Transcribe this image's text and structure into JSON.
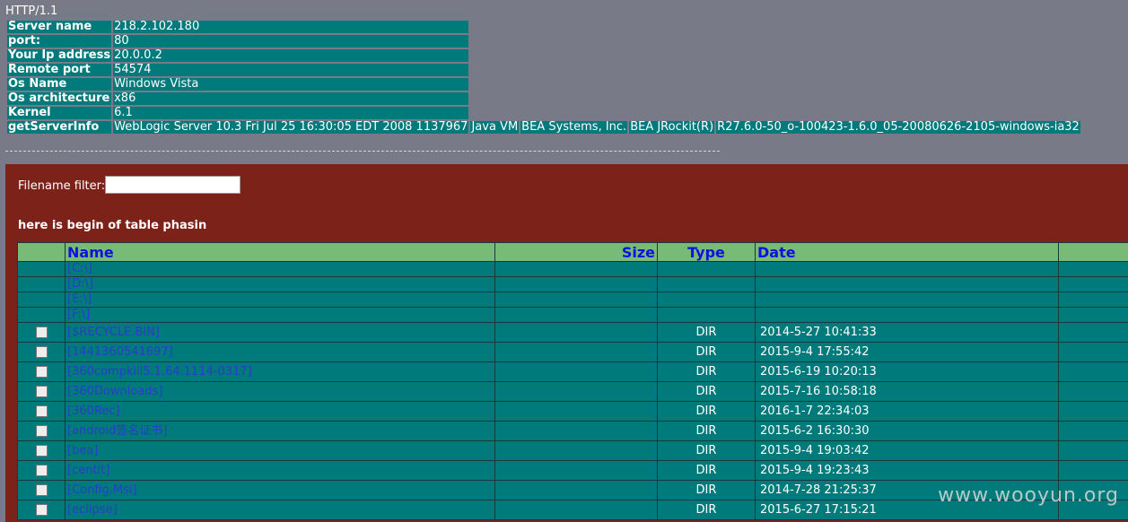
{
  "protocol": "HTTP/1.1",
  "info": [
    {
      "key": "Server name",
      "value": "218.2.102.180"
    },
    {
      "key": "port:",
      "value": "80"
    },
    {
      "key": "Your Ip address",
      "value": "20.0.0.2"
    },
    {
      "key": "Remote port",
      "value": "54574"
    },
    {
      "key": "Os Name",
      "value": "Windows Vista"
    },
    {
      "key": "Os architecture",
      "value": "x86"
    },
    {
      "key": "Kernel",
      "value": "6.1"
    }
  ],
  "server_info": {
    "key": "getServerInfo",
    "parts": [
      "WebLogic Server 10.3 Fri Jul 25 16:30:05 EDT 2008 1137967",
      "Java VM",
      "BEA Systems, Inc.",
      "BEA JRockit(R)",
      "R27.6.0-50_o-100423-1.6.0_05-20080626-2105-windows-ia32"
    ]
  },
  "separator": "------------------------------------------------------------------------------------------------------------------------------------------------",
  "filter": {
    "label": "Filename filter:",
    "value": ""
  },
  "begin_text": "here is begin of table phasin",
  "table": {
    "headers": {
      "name": "Name",
      "size": "Size",
      "type": "Type",
      "date": "Date"
    },
    "drives": [
      "[C:\\]",
      "[D:\\]",
      "[E:\\]",
      "[F:\\]"
    ],
    "rows": [
      {
        "name": "[$RECYCLE.BIN]",
        "type": "DIR",
        "date": "2014-5-27 10:41:33"
      },
      {
        "name": "[1441360541697]",
        "type": "DIR",
        "date": "2015-9-4 17:55:42"
      },
      {
        "name": "[360compkill5.1.64.1114-0317]",
        "type": "DIR",
        "date": "2015-6-19 10:20:13"
      },
      {
        "name": "[360Downloads]",
        "type": "DIR",
        "date": "2015-7-16 10:58:18"
      },
      {
        "name": "[360Rec]",
        "type": "DIR",
        "date": "2016-1-7 22:34:03"
      },
      {
        "name": "[android签名证书]",
        "type": "DIR",
        "date": "2015-6-2 16:30:30"
      },
      {
        "name": "[bea]",
        "type": "DIR",
        "date": "2015-9-4 19:03:42"
      },
      {
        "name": "[centit]",
        "type": "DIR",
        "date": "2015-9-4 19:23:43"
      },
      {
        "name": "[Config.Msi]",
        "type": "DIR",
        "date": "2014-7-28 21:25:37"
      },
      {
        "name": "[eclipse]",
        "type": "DIR",
        "date": "2015-6-27 17:15:21"
      }
    ]
  },
  "watermark": "www.wooyun.org"
}
